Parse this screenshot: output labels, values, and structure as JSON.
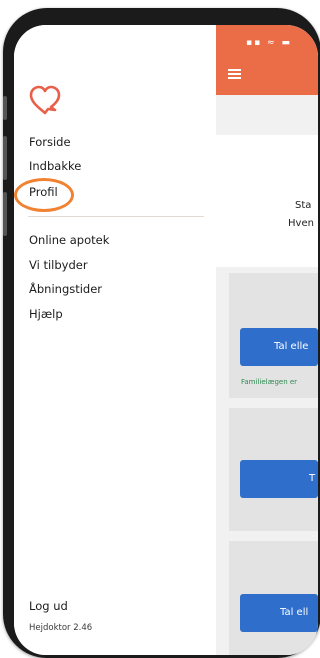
{
  "drawer": {
    "primary_items": [
      "Forside",
      "Indbakke",
      "Profil"
    ],
    "secondary_items": [
      "Online apotek",
      "Vi tilbyder",
      "Åbningstider",
      "Hjælp"
    ],
    "logout_label": "Log ud",
    "version": "Hejdoktor 2.46",
    "highlight_color": "#f08232"
  },
  "app": {
    "header_color": "#ea6d48",
    "status_icons": "▪▪ ≈ ▬",
    "intro_line1": "Sta",
    "intro_line2": "Hven",
    "cards": [
      {
        "button_label": "Tal elle"
      },
      {
        "button_label": "T"
      },
      {
        "button_label": "Tal ell"
      }
    ],
    "green_note": "Familielægen er",
    "button_color": "#2f6fcb",
    "note_color": "#2f8a52"
  }
}
